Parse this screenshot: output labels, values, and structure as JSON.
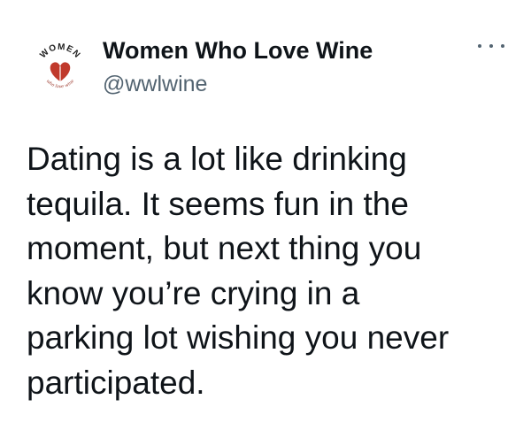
{
  "author": {
    "display_name": "Women Who Love Wine",
    "handle": "@wwlwine",
    "avatar": {
      "logo_text": "WOMEN",
      "tagline": "who love wine",
      "accent_color": "#c0392b",
      "icon": "heart-wine-glass-icon"
    }
  },
  "menu": {
    "icon": "more-options-icon"
  },
  "tweet": {
    "text": "Dating is a lot like drinking\ntequila. It seems fun in the\nmoment, but next thing you\nknow you’re crying in a\nparking lot wishing you never\nparticipated."
  },
  "colors": {
    "text_primary": "#0f1419",
    "text_secondary": "#536471",
    "background": "#ffffff"
  }
}
